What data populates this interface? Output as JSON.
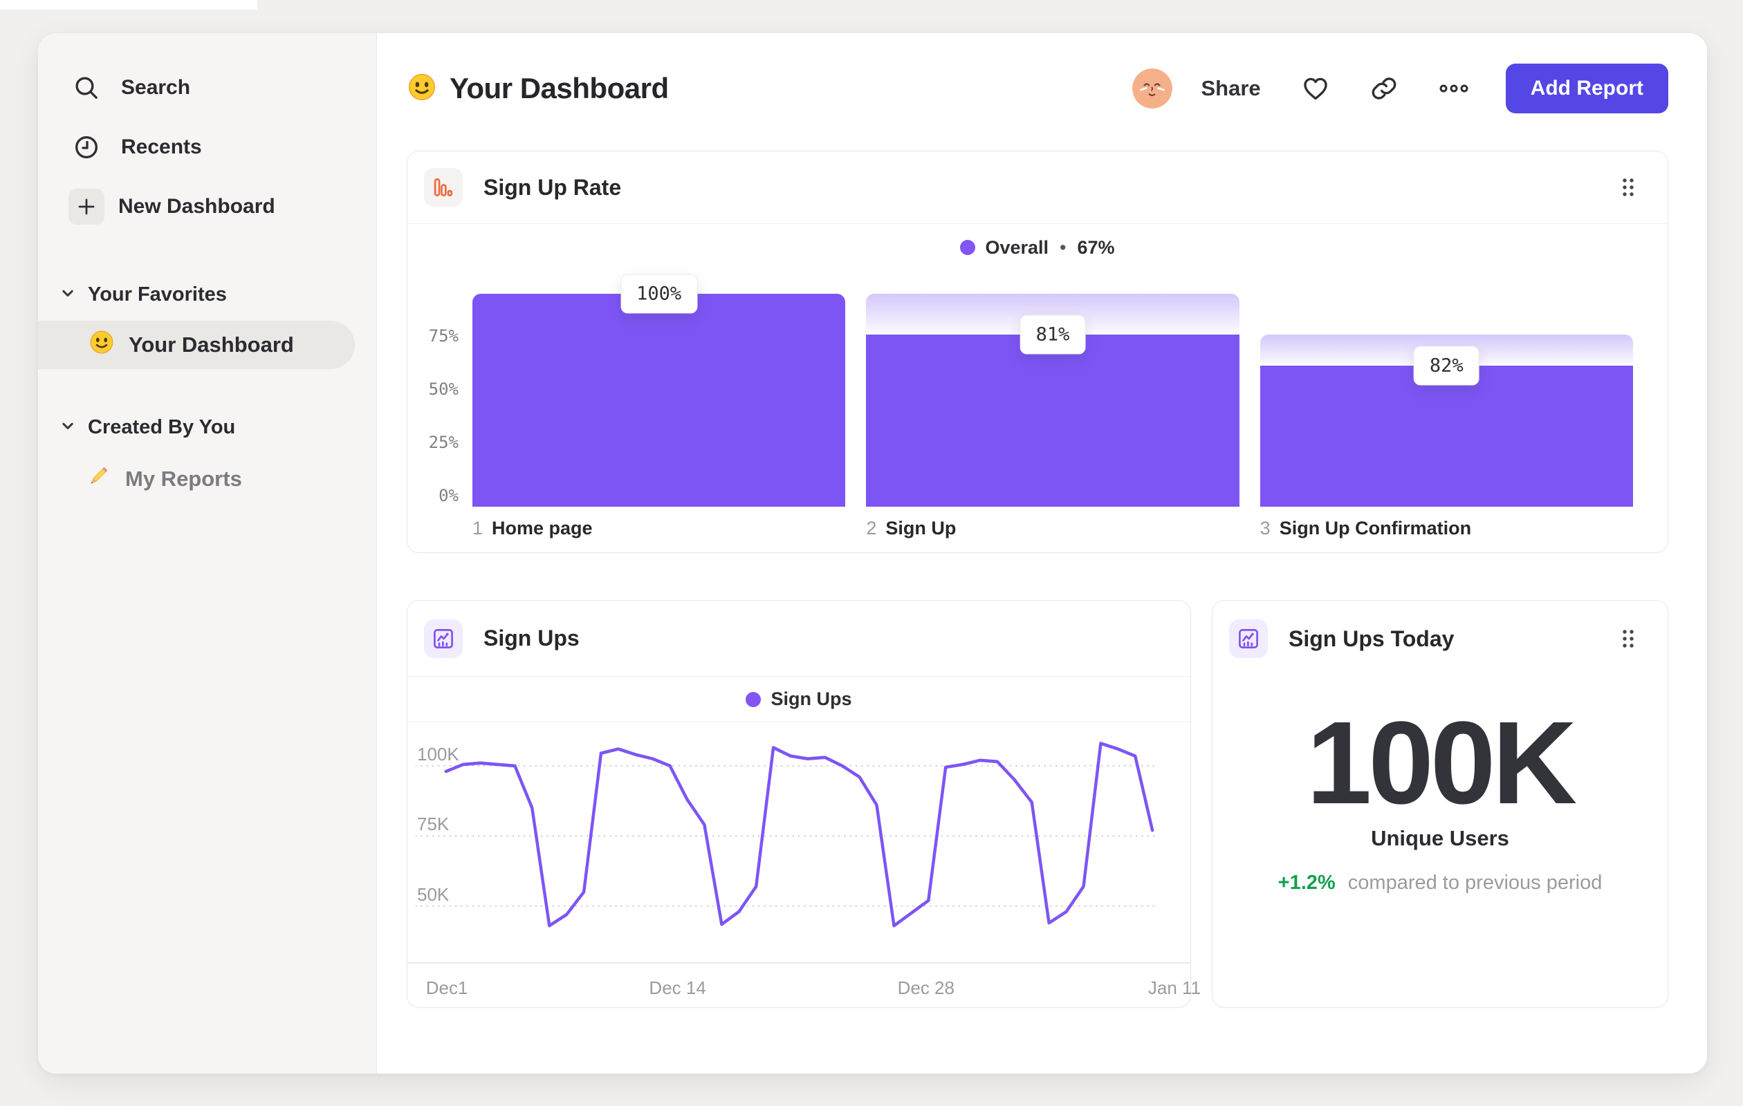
{
  "colors": {
    "accent_purple": "#7d55f4",
    "legend_dot_purple": "#8256f5",
    "button_indigo": "#5447e6",
    "icon_orange": "#ed6a3f",
    "icon_purple": "#8153f2",
    "delta_green": "#12a150",
    "page_bg": "#f1f0ee",
    "sidebar_bg": "#f6f5f3"
  },
  "sidebar": {
    "nav": [
      {
        "icon": "search-icon",
        "label": "Search"
      },
      {
        "icon": "clock-icon",
        "label": "Recents"
      },
      {
        "icon": "plus-icon",
        "label": "New Dashboard"
      }
    ],
    "sections": [
      {
        "icon": "chevron-down-icon",
        "label": "Your Favorites",
        "items": [
          {
            "icon": "smiley-icon",
            "label": "Your Dashboard",
            "active": true
          }
        ]
      },
      {
        "icon": "chevron-down-icon",
        "label": "Created By You",
        "items": [
          {
            "icon": "pencil-icon",
            "label": "My Reports",
            "active": false
          }
        ]
      }
    ]
  },
  "header": {
    "title_icon": "smiley-icon",
    "title": "Your Dashboard",
    "avatar_icon": "avatar-face-icon",
    "share_label": "Share",
    "heart_icon": "heart-icon",
    "link_icon": "link-icon",
    "more_icon": "more-ellipsis-icon",
    "add_report_label": "Add Report"
  },
  "funnel_card": {
    "icon": "funnel-chart-icon",
    "title": "Sign Up Rate",
    "drag_icon": "drag-handle-icon",
    "legend_label": "Overall",
    "legend_separator": "•",
    "legend_value": "67%",
    "chart_data": {
      "type": "bar",
      "subtype": "funnel",
      "title": "Sign Up Rate",
      "legend": "Overall • 67%",
      "overall_conversion": "67%",
      "ylim": [
        0,
        100
      ],
      "grid": false,
      "y_ticks": [
        {
          "label": "75%",
          "value": 75
        },
        {
          "label": "50%",
          "value": 50
        },
        {
          "label": "25%",
          "value": 25
        },
        {
          "label": "0%",
          "value": 0
        }
      ],
      "steps": [
        {
          "number": "1",
          "category": "Home page",
          "overall_pct": 100,
          "prev_pct": 100,
          "conversion_label": "100%"
        },
        {
          "number": "2",
          "category": "Sign Up",
          "overall_pct": 81,
          "prev_pct": 100,
          "conversion_label": "81%"
        },
        {
          "number": "3",
          "category": "Sign Up Confirmation",
          "overall_pct": 66.4,
          "prev_pct": 81,
          "conversion_label": "82%"
        }
      ]
    }
  },
  "line_card": {
    "icon": "line-chart-icon",
    "title": "Sign Ups",
    "legend_label": "Sign Ups",
    "chart_data": {
      "type": "line",
      "title": "Sign Ups",
      "legend_position": "top-center",
      "grid": "dotted-horizontal",
      "unit": "K",
      "y_domain": [
        30,
        115
      ],
      "y_ticks": [
        {
          "label": "100K",
          "value": 100
        },
        {
          "label": "75K",
          "value": 75
        },
        {
          "label": "50K",
          "value": 50
        }
      ],
      "x_ticks": [
        {
          "label": "Dec1",
          "index": 0
        },
        {
          "label": "Dec 14",
          "index": 13
        },
        {
          "label": "Dec 28",
          "index": 27
        },
        {
          "label": "Jan 11",
          "index": 41
        }
      ],
      "series": [
        {
          "name": "Sign Ups",
          "values": [
            98,
            100.5,
            101,
            100.5,
            100,
            85,
            43,
            47,
            55,
            104.5,
            106,
            104,
            102.5,
            100,
            88,
            79,
            43.5,
            48,
            57,
            106.5,
            103.5,
            102.5,
            103,
            100,
            96,
            86,
            43,
            47.5,
            52,
            99.5,
            100.5,
            102,
            101.5,
            95,
            87,
            44,
            48,
            57,
            108,
            106,
            103.5,
            77
          ]
        }
      ]
    }
  },
  "stat_card": {
    "icon": "line-chart-icon",
    "title": "Sign Ups Today",
    "drag_icon": "drag-handle-icon",
    "value": "100K",
    "label": "Unique Users",
    "delta": "+1.2%",
    "delta_note": "compared to previous period"
  }
}
